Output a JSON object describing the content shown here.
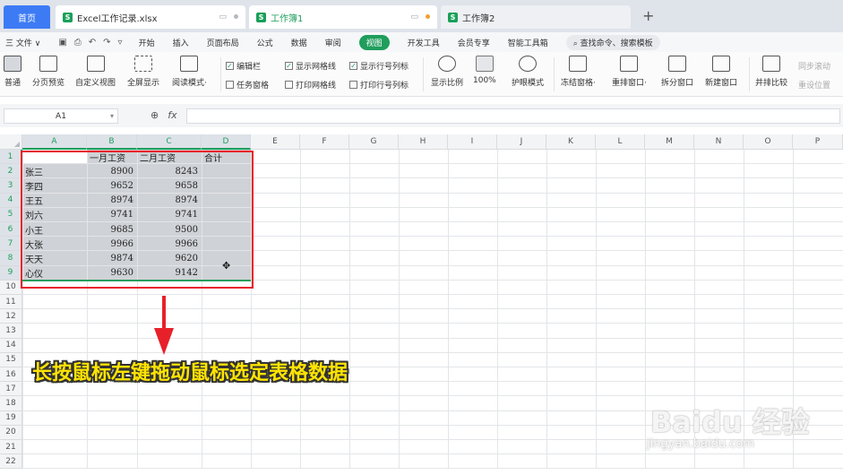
{
  "tabs": {
    "home": "首页",
    "file": "Excel工作记录.xlsx",
    "sheet1": "工作簿1",
    "sheet2": "工作簿2",
    "add": "+"
  },
  "menu": {
    "file": "三 文件 ∨",
    "items": [
      "开始",
      "插入",
      "页面布局",
      "公式",
      "数据",
      "审阅",
      "视图",
      "开发工具",
      "会员专享",
      "智能工具箱"
    ],
    "active_index": 6,
    "search": "查找命令、搜索模板"
  },
  "ribbon": {
    "buttons": [
      "普通",
      "分页预览",
      "自定义视图",
      "全屏显示",
      "阅读模式·",
      "显示比例",
      "100%",
      "护眼模式",
      "冻结窗格·",
      "重排窗口·",
      "拆分窗口",
      "新建窗口",
      "并排比较"
    ],
    "checks": [
      "编辑栏",
      "显示网格线",
      "显示行号列标",
      "任务窗格",
      "打印网格线",
      "打印行号列标"
    ],
    "checked": [
      true,
      true,
      true,
      false,
      false,
      false
    ],
    "extra": [
      "同步滚动",
      "重设位置"
    ]
  },
  "formula_bar": {
    "cell_ref": "A1",
    "fx": "fx"
  },
  "grid": {
    "columns": [
      "A",
      "B",
      "C",
      "D",
      "E",
      "F",
      "G",
      "H",
      "I",
      "J",
      "K",
      "L",
      "M",
      "N",
      "O",
      "P"
    ],
    "rows": [
      "1",
      "2",
      "3",
      "4",
      "5",
      "6",
      "7",
      "8",
      "9",
      "10",
      "11",
      "12",
      "13",
      "14",
      "15",
      "16",
      "17",
      "18",
      "19",
      "20",
      "21",
      "22"
    ],
    "header": [
      "",
      "一月工资",
      "二月工资",
      "合计"
    ],
    "data": [
      [
        "张三",
        "8900",
        "8243"
      ],
      [
        "李四",
        "9652",
        "9658"
      ],
      [
        "王五",
        "8974",
        "8974"
      ],
      [
        "刘六",
        "9741",
        "9741"
      ],
      [
        "小王",
        "9685",
        "9500"
      ],
      [
        "大张",
        "9966",
        "9966"
      ],
      [
        "天天",
        "9874",
        "9620"
      ],
      [
        "心仪",
        "9630",
        "9142"
      ]
    ]
  },
  "annotation": {
    "caption": "长按鼠标左键拖动鼠标选定表格数据",
    "arrow_color": "#e8202a",
    "box_color": "#e8202a"
  },
  "watermark": {
    "main": "Baidu 经验",
    "sub": "jingyan.baidu.com"
  },
  "colors": {
    "accent_green": "#1f9e5c",
    "home_blue": "#3d7bf5",
    "caption_yellow": "#ffe400"
  }
}
